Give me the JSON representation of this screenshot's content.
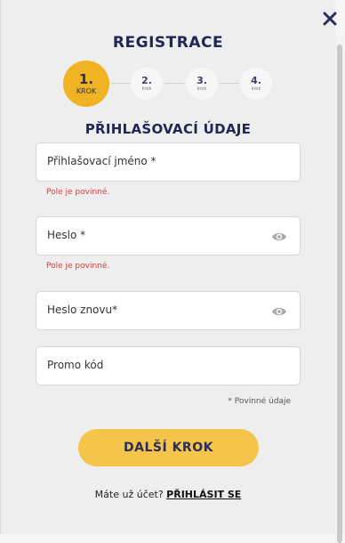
{
  "modal": {
    "title": "REGISTRACE",
    "close_icon": "close-icon"
  },
  "steps": [
    {
      "number": "1.",
      "label": "KROK",
      "state": "active"
    },
    {
      "number": "2.",
      "label": "krok",
      "state": "inactive"
    },
    {
      "number": "3.",
      "label": "krok",
      "state": "inactive"
    },
    {
      "number": "4.",
      "label": "krok",
      "state": "inactive"
    }
  ],
  "section": {
    "title": "PŘIHLAŠOVACÍ ÚDAJE"
  },
  "fields": {
    "username": {
      "placeholder": "Přihlašovací jméno *",
      "error": "Pole je povinné."
    },
    "password": {
      "placeholder": "Heslo *",
      "error": "Pole je povinné.",
      "icon": "eye-icon"
    },
    "password_repeat": {
      "placeholder": "Heslo znovu*",
      "icon": "eye-icon"
    },
    "promo": {
      "placeholder": "Promo kód"
    }
  },
  "required_note": "* Povinné údaje",
  "next_button": "DALŠÍ KROK",
  "login": {
    "prompt": "Máte už účet?",
    "link": "PŘIHLÁSIT SE"
  },
  "colors": {
    "accent": "#f0b323",
    "button": "#f5c44a",
    "navy": "#232554",
    "error": "#e03a3a"
  }
}
